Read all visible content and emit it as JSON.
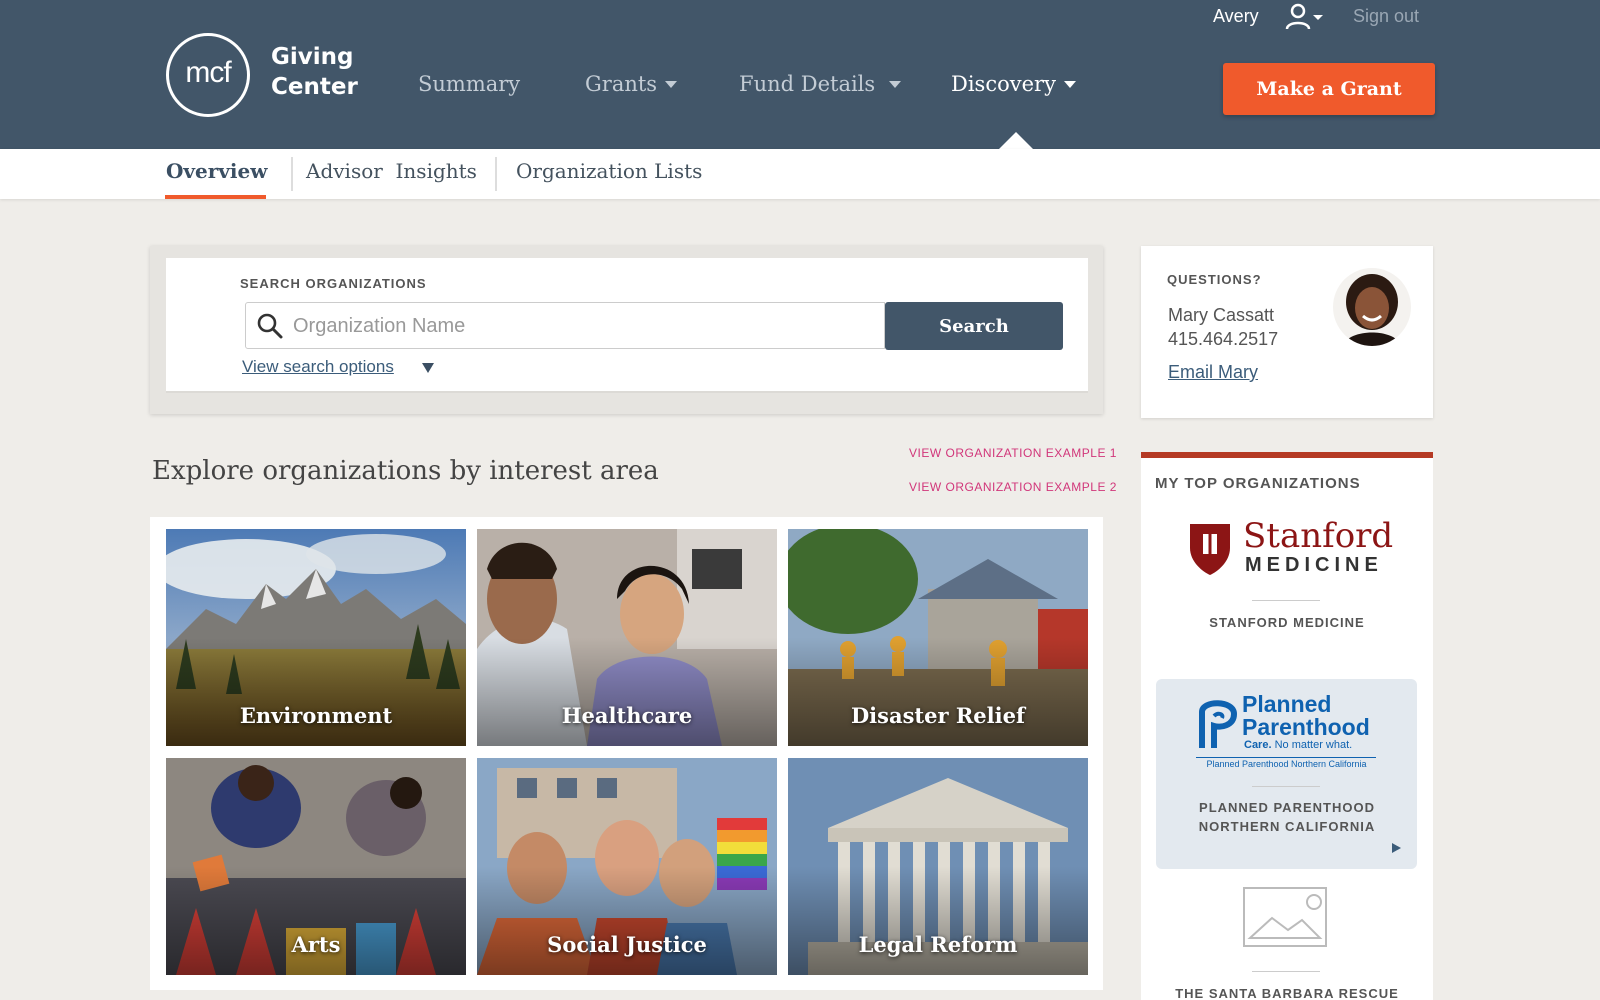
{
  "header": {
    "logo_text": "mcf",
    "logo_name_line1": "Giving",
    "logo_name_line2": "Center",
    "user_name": "Avery",
    "sign_out": "Sign out",
    "nav": [
      {
        "label": "Summary"
      },
      {
        "label": "Grants"
      },
      {
        "label": "Fund Details"
      },
      {
        "label": "Discovery"
      }
    ],
    "make_grant": "Make a Grant"
  },
  "subnav": {
    "tabs": [
      {
        "label": "Overview"
      },
      {
        "label": "Advisor  Insights"
      },
      {
        "label": "Organization Lists"
      }
    ]
  },
  "search": {
    "label": "SEARCH ORGANIZATIONS",
    "placeholder": "Organization Name",
    "button": "Search",
    "options_link": "View search options"
  },
  "explore": {
    "title": "Explore organizations by interest area",
    "example1": "VIEW ORGANIZATION EXAMPLE 1",
    "example2": "VIEW ORGANIZATION EXAMPLE 2",
    "tiles": [
      {
        "label": "Environment"
      },
      {
        "label": "Healthcare"
      },
      {
        "label": "Disaster Relief"
      },
      {
        "label": "Arts"
      },
      {
        "label": "Social Justice"
      },
      {
        "label": "Legal Reform"
      }
    ]
  },
  "questions": {
    "label": "QUESTIONS?",
    "name": "Mary Cassatt",
    "phone": "415.464.2517",
    "email": "Email Mary"
  },
  "top_orgs": {
    "label": "MY TOP ORGANIZATIONS",
    "orgs": [
      {
        "name": "STANFORD MEDICINE",
        "logo_line1": "Stanford",
        "logo_line2": "MEDICINE"
      },
      {
        "name_line1": "PLANNED PARENTHOOD",
        "name_line2": "NORTHERN CALIFORNIA",
        "logo_line1": "Planned",
        "logo_line2": "Parenthood",
        "logo_tagline_bold": "Care.",
        "logo_tagline_rest": " No matter what.",
        "logo_sub": "Planned Parenthood Northern California"
      },
      {
        "name": "THE SANTA BARBARA RESCUE"
      }
    ]
  },
  "colors": {
    "header_bg": "#425669",
    "accent_orange": "#f05a2c",
    "link_pink": "#d1367a",
    "stanford_red": "#8c1515",
    "pp_blue": "#0f62b0"
  }
}
